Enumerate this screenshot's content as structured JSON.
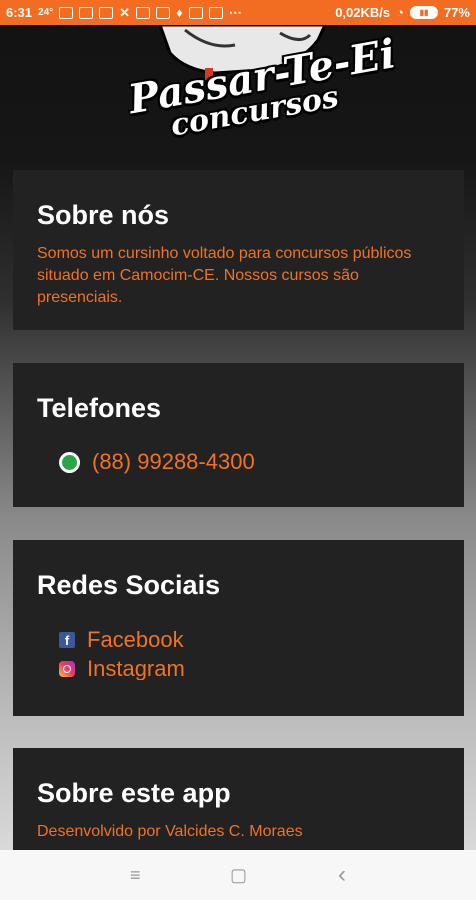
{
  "status_bar": {
    "time": "6:31",
    "temperature": "24°",
    "net_speed": "0,02KB/s",
    "battery": "77%",
    "colors": {
      "background": "#f26d21"
    }
  },
  "logo": {
    "line1": "Passar-Te-Ei",
    "line2": "concursos"
  },
  "about_us": {
    "title": "Sobre nós",
    "text": "Somos um cursinho voltado para concursos públicos situado em Camocim-CE. Nossos cursos são presenciais."
  },
  "phones": {
    "title": "Telefones",
    "number": "(88) 99288-4300",
    "icon": "whatsapp-icon"
  },
  "social": {
    "title": "Redes Sociais",
    "items": [
      {
        "label": "Facebook",
        "icon": "facebook-icon"
      },
      {
        "label": "Instagram",
        "icon": "instagram-icon"
      }
    ]
  },
  "about_app": {
    "title": "Sobre este app",
    "text": "Desenvolvido por Valcides C. Moraes"
  },
  "nav": {
    "menu": "≡",
    "home": "▢",
    "back": "‹"
  },
  "colors": {
    "accent": "#f07224",
    "card_bg": "#222222"
  }
}
